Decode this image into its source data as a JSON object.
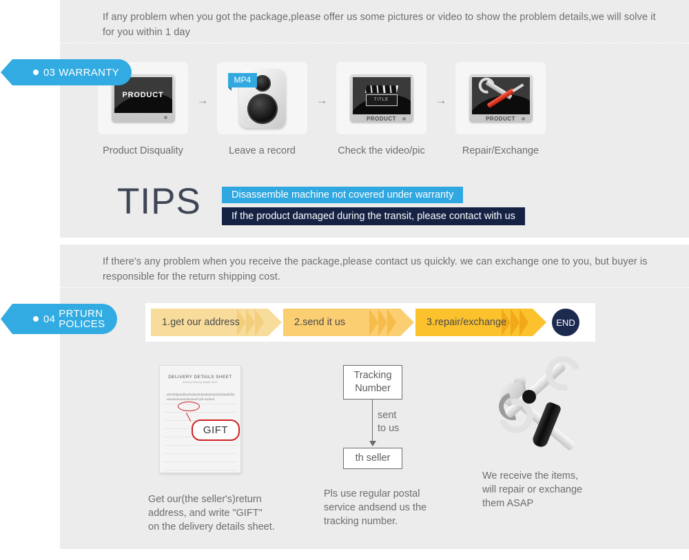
{
  "colors": {
    "panel_bg": "#ececec",
    "tag_blue": "#32abe2",
    "tip_blue": "#2fa7e0",
    "tip_navy": "#152244",
    "end_navy": "#1d2a50",
    "chev_1": "#f8dc9b",
    "chev_2": "#fbce72",
    "chev_3": "#fcc22e",
    "red_accent": "#cf2020"
  },
  "warranty": {
    "intro": "If any problem when you got the package,please offer us some pictures or video to show the problem details,we will solve it for you within 1 day",
    "tag": {
      "number": "03",
      "label": "WARRANTY"
    },
    "steps": [
      {
        "caption": "Product Disquality",
        "icon": "monitor-product-icon",
        "screen_text": "PRODUCT"
      },
      {
        "caption": "Leave a record",
        "icon": "mp4-speaker-icon",
        "badge": "MP4"
      },
      {
        "caption": "Check the video/pic",
        "icon": "monitor-clapper-icon",
        "base_text": "PRODUCT",
        "clapper_text": "TITLE"
      },
      {
        "caption": "Repair/Exchange",
        "icon": "monitor-tools-icon",
        "base_text": "PRODUCT"
      }
    ],
    "step_arrow": "→",
    "tips": {
      "heading": "TIPS",
      "lines": [
        "Disassemble machine not covered under warranty",
        "If the product damaged during the transit, please contact with us"
      ]
    }
  },
  "returns": {
    "intro": "If  there's any problem when you receive the package,please contact us quickly. we can exchange one to you, but buyer is responsible for the return shipping cost.",
    "tag": {
      "number": "04",
      "label_line1": "PRTURN",
      "label_line2": "POLICES"
    },
    "steps": [
      {
        "label": "1.get our address"
      },
      {
        "label": "2.send it us"
      },
      {
        "label": "3.repair/exchange"
      }
    ],
    "end_label": "END",
    "columns": [
      {
        "graphic": "delivery-details-sheet",
        "sheet_title": "DELIVERY DETAILS SHEET",
        "sheet_subtitle": "delivery        delivery details sheet",
        "sheet_body": "abcdefgasddsadcdsadsdsadsasdasdsadsadsfasdasdasdusasdasdasdf gift asdasd",
        "sheet_gift_word": "gift",
        "callout": "GIFT",
        "caption": "Get our(the seller's)return\naddress, and write \"GIFT\"\non the delivery details sheet."
      },
      {
        "graphic": "tracking-number-flow",
        "box_top": "Tracking\nNumber",
        "arrow_label": "sent\nto us",
        "box_bottom": "th seller",
        "caption": "Pls use regular postal\nservice andsend us the\n tracking number."
      },
      {
        "graphic": "hammer-wrench-screwdriver",
        "caption": "We receive the items,\nwill repair or exchange\n them ASAP"
      }
    ]
  }
}
